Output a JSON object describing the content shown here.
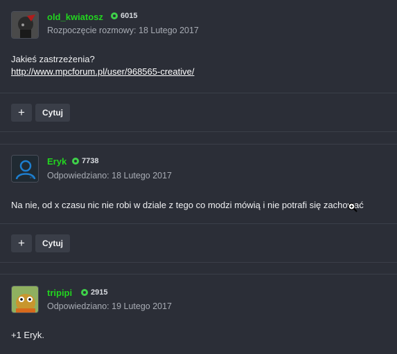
{
  "posts": [
    {
      "username": "old_kwiatosz",
      "reputation": "6015",
      "meta": "Rozpoczęcie rozmowy: 18 Lutego 2017",
      "line1": "Jakieś zastrzeżenia?",
      "link": "http://www.mpcforum.pl/user/968565-creative/",
      "plus_label": "+",
      "quote_label": "Cytuj"
    },
    {
      "username": "Eryk",
      "reputation": "7738",
      "meta": "Odpowiedziano: 18 Lutego 2017",
      "line1": "Na nie, od x czasu nic nie robi w dziale z tego co modzi mówią i nie potrafi się zachować",
      "plus_label": "+",
      "quote_label": "Cytuj"
    },
    {
      "username": "tripipi",
      "reputation": "2915",
      "meta": "Odpowiedziano: 19 Lutego 2017",
      "line1": "+1 Eryk."
    }
  ],
  "colors": {
    "background": "#2b2e37",
    "username": "#22d41f",
    "reputation_dot": "#3fd14a",
    "button": "#3a3e48"
  },
  "icons": {
    "reputation": "reputation-icon",
    "cursor": "zoom-cursor-icon"
  }
}
